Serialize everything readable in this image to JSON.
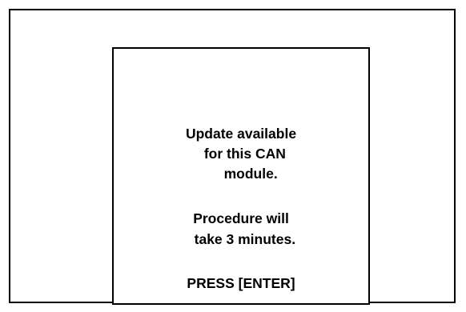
{
  "dialog": {
    "message_lines": [
      "Update available",
      "  for this CAN",
      "     module.",
      "Procedure will",
      "  take 3 minutes."
    ],
    "prompt": "PRESS [ENTER]"
  }
}
